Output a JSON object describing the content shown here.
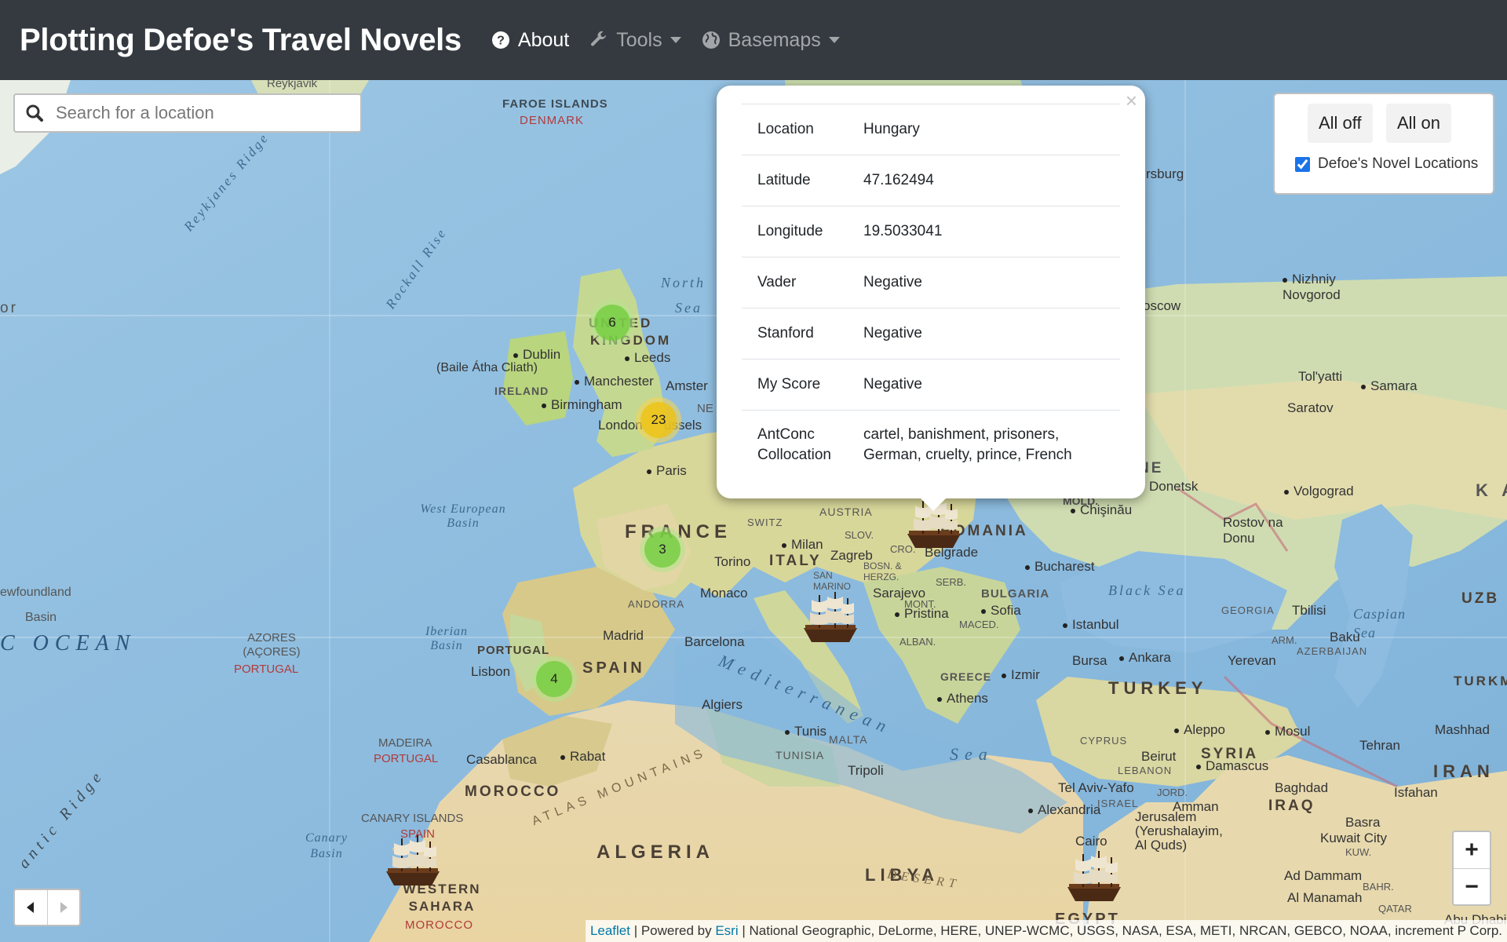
{
  "navbar": {
    "title": "Plotting Defoe's Travel Novels",
    "items": [
      {
        "label": "About",
        "icon": "question-circle-icon"
      },
      {
        "label": "Tools",
        "icon": "wrench-icon"
      },
      {
        "label": "Basemaps",
        "icon": "globe-icon"
      }
    ]
  },
  "search": {
    "placeholder": "Search for a location"
  },
  "popup": {
    "close": "×",
    "rows": [
      {
        "key": "Location",
        "value": "Hungary"
      },
      {
        "key": "Latitude",
        "value": "47.162494"
      },
      {
        "key": "Longitude",
        "value": "19.5033041"
      },
      {
        "key": "Vader",
        "value": "Negative"
      },
      {
        "key": "Stanford",
        "value": "Negative"
      },
      {
        "key": "My Score",
        "value": "Negative"
      },
      {
        "key": "AntConc Collocation",
        "value": "cartel, banishment, prisoners, German, cruelty, prince, French"
      }
    ]
  },
  "layers": {
    "all_off": "All off",
    "all_on": "All on",
    "layer_label": "Defoe's Novel Locations",
    "layer_checked": true
  },
  "clusters": [
    {
      "count": "6",
      "color": "green"
    },
    {
      "count": "23",
      "color": "yellow"
    },
    {
      "count": "3",
      "color": "green"
    },
    {
      "count": "4",
      "color": "green"
    }
  ],
  "zoom": {
    "in": "+",
    "out": "−"
  },
  "attribution": {
    "leaflet": "Leaflet",
    "powered": " | Powered by ",
    "esri": "Esri",
    "sources": " | National Geographic, DeLorme, HERE, UNEP-WCMC, USGS, NASA, ESA, METI, NRCAN, GEBCO, NOAA, increment P Corp."
  },
  "map_labels": {
    "faroe": "FAROE ISLANDS",
    "denmark": "DENMARK",
    "reykjavik": "Reykjavik",
    "reykjanes": "Reykjanes Ridge",
    "rockall": "Rockall Rise",
    "north_sea": "North",
    "sea2": "Sea",
    "uk1": "UNITED",
    "uk2": "KINGDOM",
    "dublin": "Dublin",
    "baile": "(Baile Átha Cliath)",
    "ireland": "IRELAND",
    "leeds": "Leeds",
    "manchester": "Manchester",
    "birmingham": "Birmingham",
    "london": "London",
    "amsterdam": "Amster",
    "brussels": "ussels",
    "paris": "Paris",
    "france": "FRANCE",
    "west_basin": "West European Basin",
    "newfoundland": "ewfoundland",
    "basin": "Basin",
    "ocean": "C OCEAN",
    "azores": "AZORES (AÇORES)",
    "portugal_red": "PORTUGAL",
    "iberian": "Iberian Basin",
    "portugal": "PORTUGAL",
    "lisbon": "Lisbon",
    "spain": "SPAIN",
    "madrid": "Madrid",
    "barcelona": "Barcelona",
    "andorra": "ANDORRA",
    "monaco": "Monaco",
    "torino": "Torino",
    "milan": "Milan",
    "italy": "ITALY",
    "switz": "SWITZ",
    "austria": "AUSTRIA",
    "slov": "SLOV.",
    "zagreb": "Zagreb",
    "cro": "CRO.",
    "bosn": "BOSN. & HERZG.",
    "sarajevo": "Sarajevo",
    "san_marino": "SAN MARINO",
    "serb": "SERB.",
    "belgrade": "Belgrade",
    "romania": "ROMANIA",
    "bucharest": "Bucharest",
    "bulgaria": "BULGARIA",
    "sofia": "Sofia",
    "mont": "MONT.",
    "pristina": "Pristina",
    "maced": "MACED.",
    "alban": "ALBAN.",
    "greece": "GREECE",
    "athens": "Athens",
    "izmir": "Izmir",
    "istanbul": "Istanbul",
    "bursa": "Bursa",
    "ankara": "Ankara",
    "turkey": "TURKEY",
    "black_sea": "Black Sea",
    "mold": "MOLD.",
    "chisinau": "Chişinău",
    "donetsk": "Donetsk",
    "volgograd": "Volgograd",
    "rostov": "Rostov na Donu",
    "georgia": "GEORGIA",
    "tbilisi": "Tbilisi",
    "caspian": "Caspian Sea",
    "baku": "Baku",
    "azerbaijan": "AZERBAIJAN",
    "yerevan": "Yerevan",
    "arm": "ARM.",
    "moscow": "oscow",
    "nizhniy": "Nizhniy Novgorod",
    "tolyatti": "Tol'yatti",
    "samara": "Samara",
    "saratov": "Saratov",
    "burg": "rsburg",
    "uzb": "UZB",
    "turkmen": "TURKMEN",
    "mashhad": "Mashhad",
    "tehran": "Tehran",
    "iran": "IRAN",
    "isfahan": "Isfahan",
    "mosul": "Mosul",
    "aleppo": "Aleppo",
    "syria": "SYRIA",
    "damascus": "Damascus",
    "beirut": "Beirut",
    "lebanon": "LEBANON",
    "cyprus": "CYPRUS",
    "telaviv": "Tel Aviv-Yafo",
    "israel": "ISRAEL",
    "jord": "JORD.",
    "amman": "Amman",
    "jerusalem": "Jerusalem (Yerushalayim, Al Quds)",
    "baghdad": "Baghdad",
    "iraq": "IRAQ",
    "basra": "Basra",
    "kuwait": "Kuwait City",
    "kuw": "KUW.",
    "dammam": "Ad Dammam",
    "bahr": "BAHR.",
    "manamah": "Al Manamah",
    "qatar": "QATAR",
    "abu": "Abu Dhabi",
    "alexandria": "Alexandria",
    "cairo": "Cairo",
    "egypt": "EGYPT",
    "libya": "LIBYA",
    "desert": "DESERT",
    "tripoli": "Tripoli",
    "tunis": "Tunis",
    "tunisia": "TUNISIA",
    "malta": "MALTA",
    "algiers": "Algiers",
    "algeria": "ALGERIA",
    "med": "Mediterranean",
    "sea3": "Sea",
    "atlas": "ATLAS MOUNTAINS",
    "rabat": "Rabat",
    "casablanca": "Casablanca",
    "morocco": "MOROCCO",
    "madeira": "MADEIRA",
    "portugal2": "PORTUGAL",
    "canary_islands": "CANARY ISLANDS",
    "spain_red": "SPAIN",
    "canary_basin": "Canary Basin",
    "western_sahara": "WESTERN SAHARA",
    "morocco_red": "MOROCCO",
    "atlantic_ridge": "antic Ridge",
    "or": "or",
    "ne": "NE",
    "kaz": "K A"
  }
}
